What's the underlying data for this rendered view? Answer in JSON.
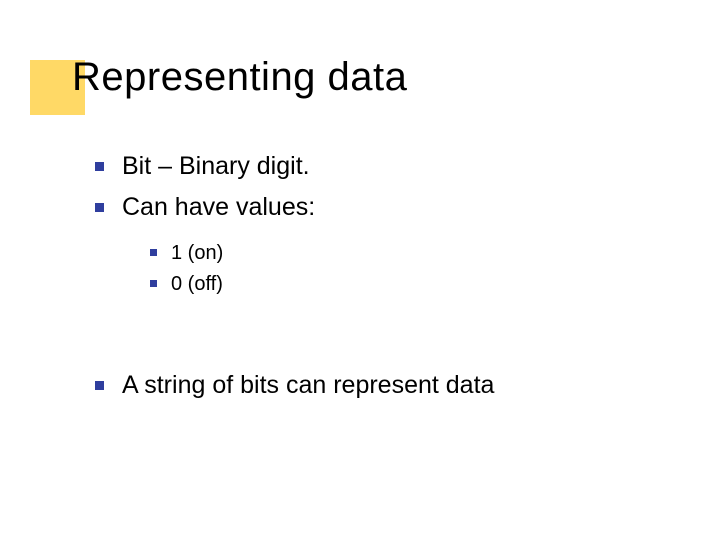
{
  "title": "Representing data",
  "bullets": {
    "b1": "Bit – Binary digit.",
    "b2": "Can have values:",
    "sub1": "1 (on)",
    "sub2": "0 (off)",
    "b3": "A string of bits can represent data"
  }
}
